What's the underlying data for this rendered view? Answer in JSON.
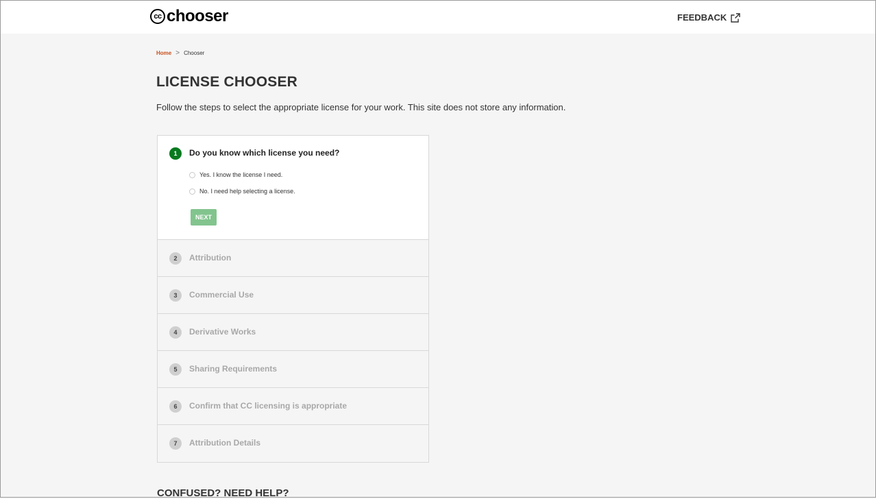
{
  "header": {
    "logo_badge": "cc",
    "logo_word": "chooser",
    "feedback_label": "FEEDBACK"
  },
  "breadcrumb": {
    "home": "Home",
    "separator": ">",
    "current": "Chooser"
  },
  "page": {
    "title": "LICENSE CHOOSER",
    "subtitle": "Follow the steps to select the appropriate license for your work. This site does not store any information."
  },
  "active_step": {
    "number": "1",
    "question": "Do you know which license you need?",
    "option_yes": "Yes. I know the license I need.",
    "option_no": "No. I need help selecting a license.",
    "next_label": "NEXT"
  },
  "steps": [
    {
      "number": "2",
      "label": "Attribution"
    },
    {
      "number": "3",
      "label": "Commercial Use"
    },
    {
      "number": "4",
      "label": "Derivative Works"
    },
    {
      "number": "5",
      "label": "Sharing Requirements"
    },
    {
      "number": "6",
      "label": "Confirm that CC licensing is appropriate"
    },
    {
      "number": "7",
      "label": "Attribution Details"
    }
  ],
  "help": {
    "title": "CONFUSED? NEED HELP?"
  },
  "colors": {
    "active_step": "#067a1f",
    "next_button": "#82c48e",
    "breadcrumb_link": "#c8501e"
  }
}
